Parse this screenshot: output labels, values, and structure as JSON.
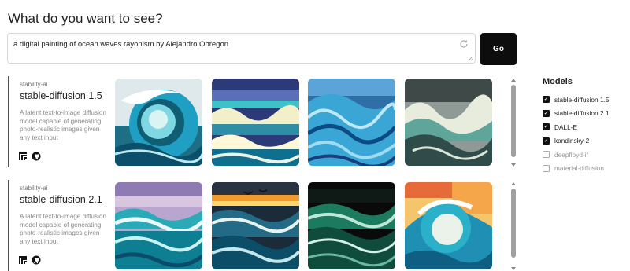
{
  "heading": "What do you want to see?",
  "prompt": {
    "value": "a digital painting of ocean waves rayonism by Alejandro Obregon"
  },
  "go_label": "Go",
  "rows": [
    {
      "org": "stability-ai",
      "name": "stable-diffusion 1.5",
      "description": "A latent text-to-image diffusion model capable of generating photo-realistic images given any text input",
      "images": [
        "Wave image 1",
        "Wave image 2",
        "Wave image 3",
        "Wave image 4"
      ]
    },
    {
      "org": "stability-ai",
      "name": "stable-diffusion 2.1",
      "description": "A latent text-to-image diffusion model capable of generating photo-realistic images given any text input",
      "images": [
        "Wave image 5",
        "Wave image 6",
        "Wave image 7",
        "Wave image 8"
      ]
    }
  ],
  "models_panel": {
    "title": "Models",
    "options": [
      {
        "label": "stable-diffusion 1.5",
        "checked": true
      },
      {
        "label": "stable-diffusion 2.1",
        "checked": true
      },
      {
        "label": "DALL-E",
        "checked": true
      },
      {
        "label": "kandinsky-2",
        "checked": true
      },
      {
        "label": "deepfloyd-if",
        "checked": false
      },
      {
        "label": "material-diffusion",
        "checked": false
      }
    ]
  },
  "colors": {
    "button_bg": "#0d0d0d",
    "checkbox_on": "#111111",
    "accent_border": "#555555"
  }
}
